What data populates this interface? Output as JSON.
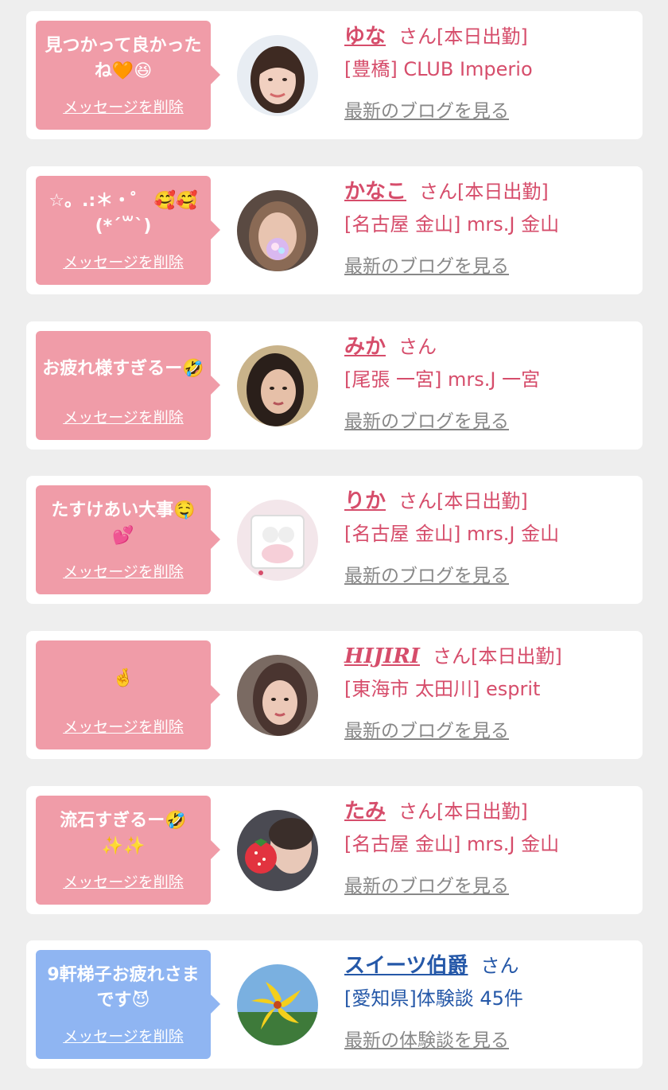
{
  "cards": [
    {
      "message": "見つかって良かったね🧡😆",
      "delete_label": "メッセージを削除",
      "name": "ゆな",
      "suffix": "さん[本日出勤]",
      "shop": "[豊橋] CLUB Imperio",
      "blog_label": "最新のブログを見る"
    },
    {
      "message": "☆。.:＊・゜ 🥰🥰(*´꒳`)",
      "delete_label": "メッセージを削除",
      "name": "かなこ",
      "suffix": "さん[本日出勤]",
      "shop": "[名古屋 金山] mrs.J 金山",
      "blog_label": "最新のブログを見る"
    },
    {
      "message": "お疲れ様すぎるー🤣",
      "delete_label": "メッセージを削除",
      "name": "みか",
      "suffix": "さん",
      "shop": "[尾張 一宮] mrs.J 一宮",
      "blog_label": "最新のブログを見る"
    },
    {
      "message": "たすけあい大事🤤💕",
      "delete_label": "メッセージを削除",
      "name": "りか",
      "suffix": "さん[本日出勤]",
      "shop": "[名古屋 金山] mrs.J 金山",
      "blog_label": "最新のブログを見る"
    },
    {
      "message": "🤞",
      "delete_label": "メッセージを削除",
      "name": "HIJIRI",
      "suffix": "さん[本日出勤]",
      "shop": "[東海市 太田川] esprit",
      "blog_label": "最新のブログを見る"
    },
    {
      "message": "流石すぎるー🤣✨✨",
      "delete_label": "メッセージを削除",
      "name": "たみ",
      "suffix": "さん[本日出勤]",
      "shop": "[名古屋 金山] mrs.J 金山",
      "blog_label": "最新のブログを見る"
    },
    {
      "message": "9軒梯子お疲れさまです😈",
      "delete_label": "メッセージを削除",
      "name": "スイーツ伯爵",
      "suffix": "さん",
      "shop": "[愛知県]体験談 45件",
      "blog_label": "最新の体験談を見る"
    }
  ],
  "colors": {
    "pink_bubble": "#f09ca8",
    "blue_bubble": "#8fb5f2",
    "pink_text": "#d64d6b",
    "blue_text": "#2558a8",
    "gray_link": "#888888"
  },
  "icons": {
    "avatar": "profile-photo-avatar"
  }
}
